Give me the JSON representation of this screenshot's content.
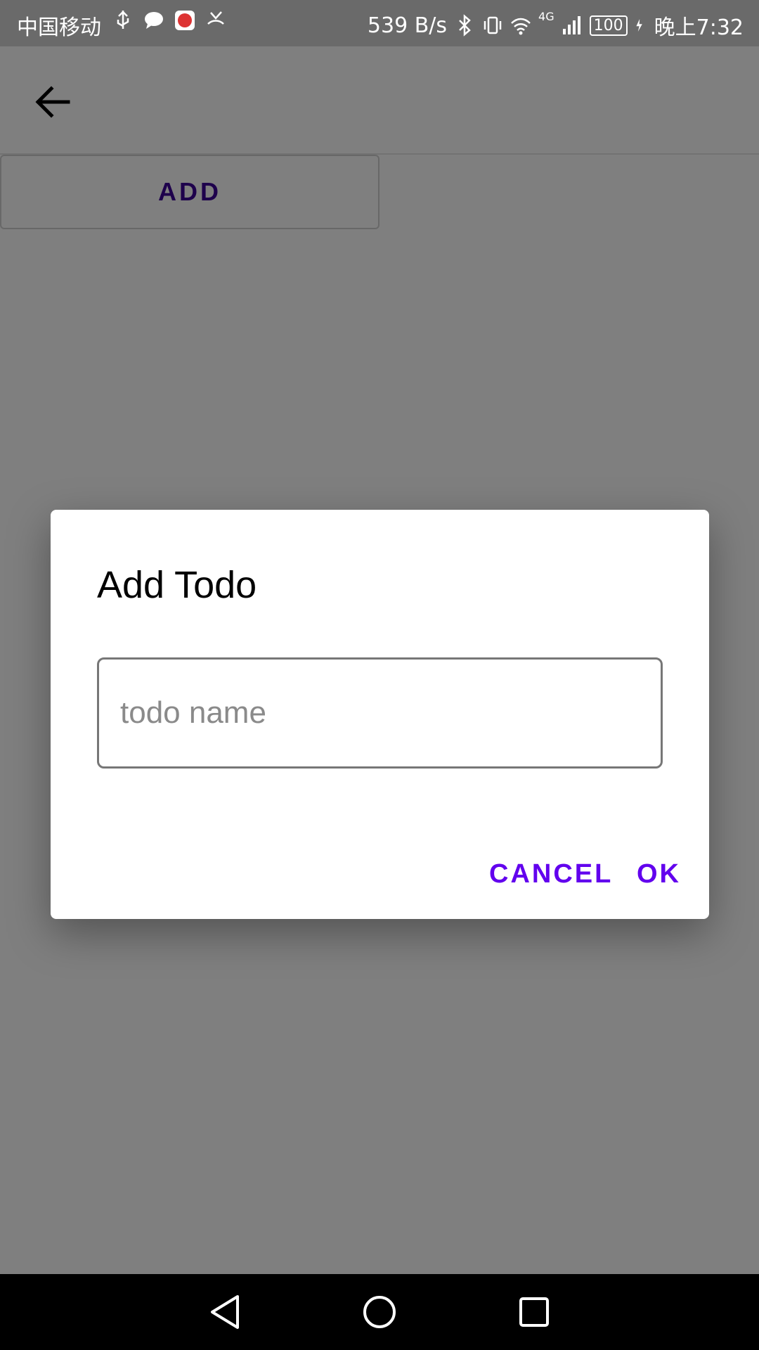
{
  "status_bar": {
    "carrier": "中国移动",
    "net_speed": "539 B/s",
    "signal_label": "4G",
    "battery": "100",
    "time": "晚上7:32"
  },
  "app_bar": {
    "back_icon": "arrow-left-icon"
  },
  "main": {
    "add_label": "ADD"
  },
  "dialog": {
    "title": "Add Todo",
    "input_value": "",
    "input_placeholder": "todo name",
    "cancel_label": "CANCEL",
    "ok_label": "OK"
  },
  "nav_bar": {
    "icons": [
      "back-triangle-icon",
      "home-circle-icon",
      "recents-square-icon"
    ]
  },
  "colors": {
    "accent": "#6200ee",
    "add_text": "#3c0099",
    "status_bar": "#6a6a6a",
    "scrim": "rgba(0,0,0,0.5)"
  }
}
